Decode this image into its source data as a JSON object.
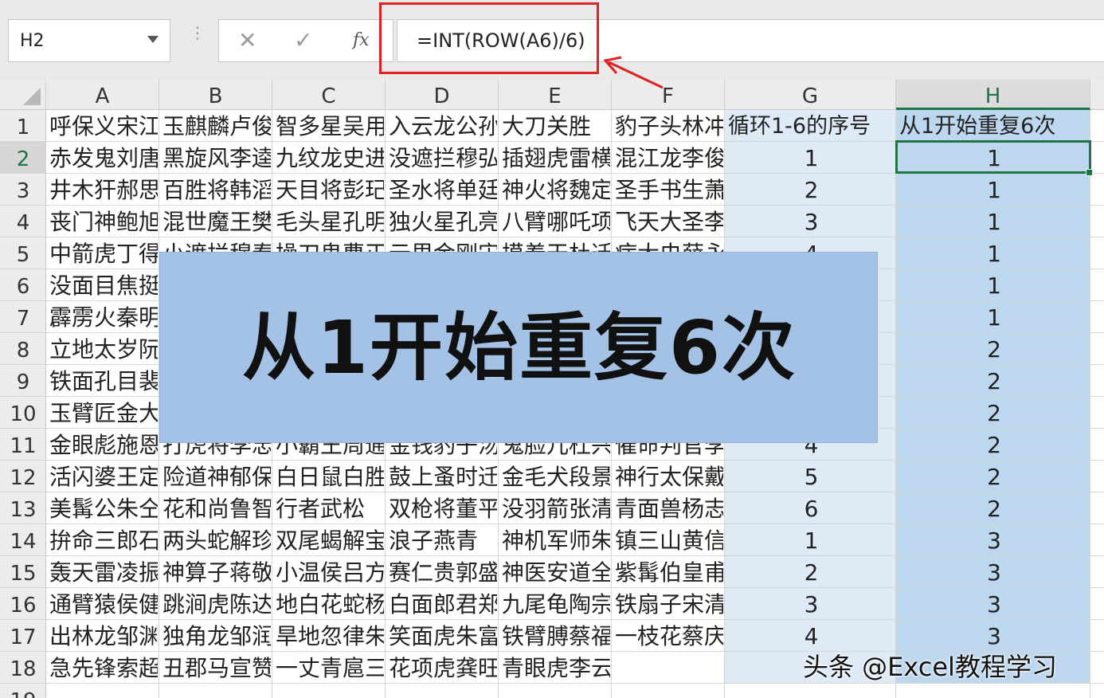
{
  "formula_bar": {
    "name_box": "H2",
    "cancel_icon": "✕",
    "confirm_icon": "✓",
    "fx_label": "fx",
    "formula": "=INT(ROW(A6)/6)"
  },
  "columns": [
    "A",
    "B",
    "C",
    "D",
    "E",
    "F",
    "G",
    "H"
  ],
  "rows": [
    "1",
    "2",
    "3",
    "4",
    "5",
    "6",
    "7",
    "8",
    "9",
    "10",
    "11",
    "12",
    "13",
    "14",
    "15",
    "16",
    "17",
    "18",
    "19"
  ],
  "cells": {
    "A": [
      "呼保义宋江",
      "赤发鬼刘唐",
      "井木犴郝思文",
      "丧门神鲍旭",
      "中箭虎丁得孙",
      "没面目焦挺",
      "霹雳火秦明",
      "立地太岁阮小二",
      "铁面孔目裴宣",
      "玉臂匠金大坚",
      "金眼彪施恩",
      "活闪婆王定六",
      "美髯公朱仝",
      "拚命三郎石秀",
      "轰天雷凌振",
      "通臂猿侯健",
      "出林龙邹渊",
      "急先锋索超"
    ],
    "B": [
      "玉麒麟卢俊义",
      "黑旋风李逵",
      "百胜将韩滔",
      "混世魔王樊瑞",
      "小遮拦穆春",
      "",
      "",
      "",
      "",
      "",
      "打虎将李忠",
      "险道神郁保四",
      "花和尚鲁智深",
      "两头蛇解珍",
      "神算子蒋敬",
      "跳涧虎陈达",
      "独角龙邹润",
      "丑郡马宣赞"
    ],
    "C": [
      "智多星吴用",
      "九纹龙史进",
      "天目将彭玘",
      "毛头星孔明",
      "操刀鬼曹正",
      "",
      "",
      "",
      "",
      "",
      "小霸王周通",
      "白日鼠白胜",
      "行者武松",
      "双尾蝎解宝",
      "小温侯吕方",
      "地白花蛇杨春",
      "旱地忽律朱贵",
      "一丈青扈三娘"
    ],
    "D": [
      "入云龙公孙胜",
      "没遮拦穆弘",
      "圣水将单廷珪",
      "独火星孔亮",
      "云里金刚宋万",
      "",
      "",
      "",
      "",
      "",
      "金钱豹子汤隆",
      "鼓上蚤时迁",
      "双枪将董平",
      "浪子燕青",
      "赛仁贵郭盛",
      "白面郎君郑天寿",
      "笑面虎朱富",
      "花项虎龚旺"
    ],
    "E": [
      "大刀关胜",
      "插翅虎雷横",
      "神火将魏定国",
      "八臂哪吒项充",
      "摸着天杜迁",
      "",
      "",
      "",
      "",
      "",
      "鬼脸儿杜兴",
      "金毛犬段景住",
      "没羽箭张清",
      "神机军师朱武",
      "神医安道全",
      "九尾龟陶宗旺",
      "铁臂膊蔡福",
      "青眼虎李云。"
    ],
    "F": [
      "豹子头林冲",
      "混江龙李俊",
      "圣手书生萧让",
      "飞天大圣李衮",
      "病大虫薛永",
      "",
      "",
      "",
      "",
      "",
      "催命判官李立",
      "神行太保戴宗",
      "青面兽杨志",
      "镇三山黄信",
      "紫髯伯皇甫端",
      "铁扇子宋清",
      "一枝花蔡庆",
      ""
    ],
    "G": [
      "循环1-6的序号",
      "1",
      "2",
      "3",
      "4",
      "",
      "",
      "",
      "",
      "",
      "4",
      "5",
      "6",
      "1",
      "2",
      "3",
      "4",
      ""
    ],
    "H": [
      "从1开始重复6次",
      "1",
      "1",
      "1",
      "1",
      "1",
      "1",
      "2",
      "2",
      "2",
      "2",
      "2",
      "2",
      "3",
      "3",
      "3",
      "3",
      ""
    ]
  },
  "banner": "从1开始重复6次",
  "watermark": "头条 @Excel教程学习",
  "colors": {
    "accent_green": "#217346",
    "highlight_red": "#e02020",
    "shade_g": "#deeaf6",
    "shade_h": "#bdd7ee",
    "banner": "#a3c2e5"
  }
}
